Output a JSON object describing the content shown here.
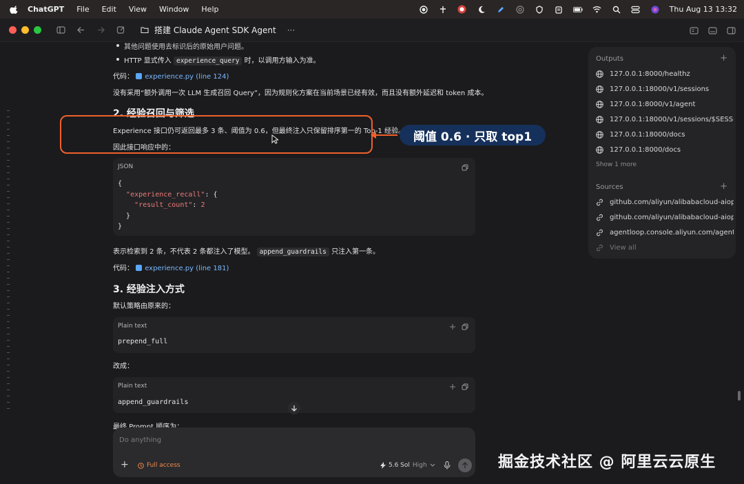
{
  "menubar": {
    "app": "ChatGPT",
    "menus": [
      "File",
      "Edit",
      "View",
      "Window",
      "Help"
    ],
    "clock": "Thu Aug 13  13:32"
  },
  "window": {
    "title": "搭建 Claude Agent SDK Agent",
    "more": "···"
  },
  "content": {
    "bullet1": "其他问题使用去标识后的原始用户问题。",
    "bullet2_pre": "HTTP 显式传入",
    "bullet2_code": "experience_query",
    "bullet2_post": "时，以调用方输入为准。",
    "code_ref1_label": "代码：",
    "code_ref1_link": "experience.py (line 124)",
    "para1": "没有采用“额外调用一次 LLM 生成召回 Query”，因为规则化方案在当前场景已经有效，而且没有额外延迟和 token 成本。",
    "h2": "2. 经验召回与筛选",
    "para2": "Experience 接口仍可返回最多 3 条、阈值为 0.6，但最终注入只保留排序第一的 Top-1 经验。",
    "para3": "因此接口响应中的：",
    "json_block": {
      "lang": "JSON",
      "l1": "{",
      "l2_key": "\"experience_recall\"",
      "l2_post": ": {",
      "l3_key": "\"result_count\"",
      "l3_colon": ": ",
      "l3_val": "2",
      "l4": "}",
      "l5": "}"
    },
    "para4_pre": "表示检索到 2 条，不代表 2 条都注入了模型。",
    "para4_code": "append_guardrails",
    "para4_post": "只注入第一条。",
    "code_ref2_label": "代码：",
    "code_ref2_link": "experience.py (line 181)",
    "h3": "3. 经验注入方式",
    "para5": "默认策略由原来的：",
    "block1": {
      "lang": "Plain text",
      "code": "prepend_full"
    },
    "para6": "改成：",
    "block2": {
      "lang": "Plain text",
      "code": "append_guardrails"
    },
    "para7": "最终 Prompt 顺序为："
  },
  "annotation": {
    "label": "阈值 0.6 · 只取 top1"
  },
  "panel": {
    "outputs_title": "Outputs",
    "outputs": [
      "127.0.0.1:8000/healthz",
      "127.0.0.1:18000/v1/sessions",
      "127.0.0.1:8000/v1/agent",
      "127.0.0.1:18000/v1/sessions/$SESSIO",
      "127.0.0.1:18000/docs",
      "127.0.0.1:8000/docs"
    ],
    "show_more": "Show 1 more",
    "sources_title": "Sources",
    "sources": [
      "github.com/aliyun/alibabacloud-aiop",
      "github.com/aliyun/alibabacloud-aiop",
      "agentloop.console.aliyun.com/agentl"
    ],
    "view_all": "View all"
  },
  "composer": {
    "placeholder": "Do anything",
    "access": "Full access",
    "model": "5.6 Sol",
    "level": "High"
  },
  "watermark": "掘金技术社区 @ 阿里云云原生",
  "colors": {
    "annotation": "#f0602c",
    "pill": "#15305a",
    "link": "#79b8ff",
    "access": "#f08a4b"
  }
}
